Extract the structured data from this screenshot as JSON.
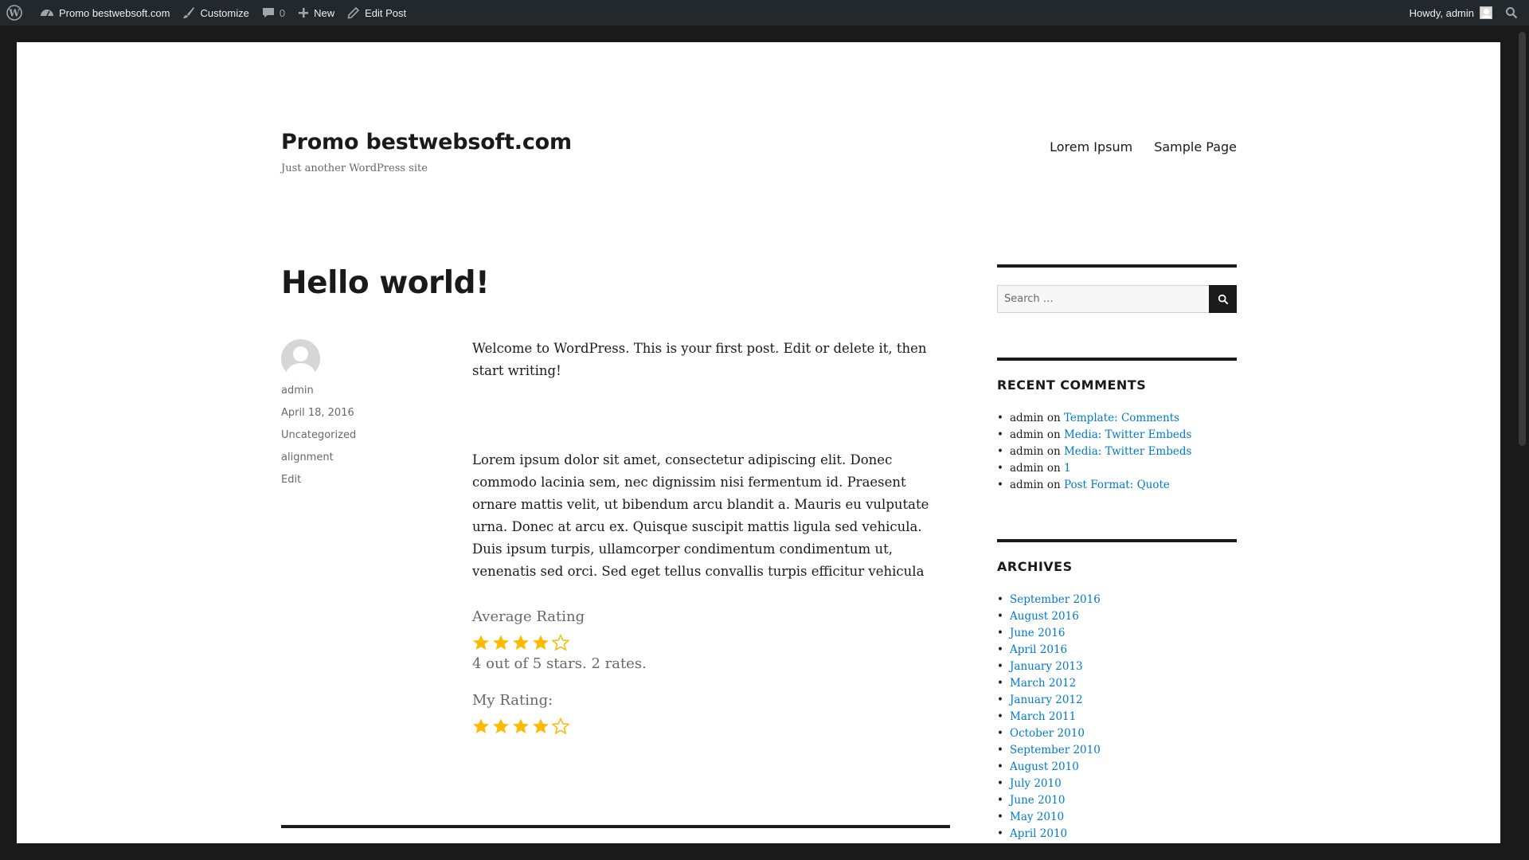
{
  "adminbar": {
    "site_name": "Promo bestwebsoft.com",
    "customize": "Customize",
    "comments_count": "0",
    "new": "New",
    "edit_post": "Edit Post",
    "howdy": "Howdy, admin"
  },
  "header": {
    "title": "Promo bestwebsoft.com",
    "description": "Just another WordPress site",
    "nav": [
      "Lorem Ipsum",
      "Sample Page"
    ]
  },
  "post": {
    "title": "Hello world!",
    "author": "admin",
    "date": "April 18, 2016",
    "category": "Uncategorized",
    "tag": "alignment",
    "edit": "Edit",
    "paragraph1": "Welcome to WordPress. This is your first post. Edit or delete it, then start writing!",
    "paragraph2": "Lorem ipsum dolor sit amet, consectetur adipiscing elit. Donec commodo lacinia sem, nec dignissim nisi fermentum id. Praesent ornare mattis velit, ut bibendum arcu blandit a. Mauris eu vulputate urna. Donec at arcu ex. Quisque suscipit mattis ligula sed vehicula. Duis ipsum turpis, ullamcorper condimentum condimentum ut, venenatis sed orci. Sed eget tellus convallis turpis efficitur vehicula",
    "average_rating_label": "Average Rating",
    "average_rating_value": 4,
    "rating_max": 5,
    "average_rating_text": "4 out of 5 stars. 2 rates.",
    "my_rating_label": "My Rating:",
    "my_rating_value": 4
  },
  "sidebar": {
    "search_placeholder": "Search …",
    "recent_comments_title": "RECENT COMMENTS",
    "recent_comments": [
      {
        "author": "admin",
        "on": "on",
        "post": "Template: Comments"
      },
      {
        "author": "admin",
        "on": "on",
        "post": "Media: Twitter Embeds"
      },
      {
        "author": "admin",
        "on": "on",
        "post": "Media: Twitter Embeds"
      },
      {
        "author": "admin",
        "on": "on",
        "post": "1"
      },
      {
        "author": "admin",
        "on": "on",
        "post": "Post Format: Quote"
      }
    ],
    "archives_title": "ARCHIVES",
    "archives": [
      "September 2016",
      "August 2016",
      "June 2016",
      "April 2016",
      "January 2013",
      "March 2012",
      "January 2012",
      "March 2011",
      "October 2010",
      "September 2010",
      "August 2010",
      "July 2010",
      "June 2010",
      "May 2010",
      "April 2010"
    ]
  },
  "colors": {
    "adminbar_bg": "#23282d",
    "link": "#007acc",
    "star": "#ffb900",
    "text": "#1a1a1a"
  },
  "icons": {
    "adminbar": [
      "wordpress-logo-icon",
      "dashboard-icon",
      "brush-icon",
      "comment-icon",
      "plus-icon",
      "pencil-icon",
      "search-icon"
    ]
  }
}
